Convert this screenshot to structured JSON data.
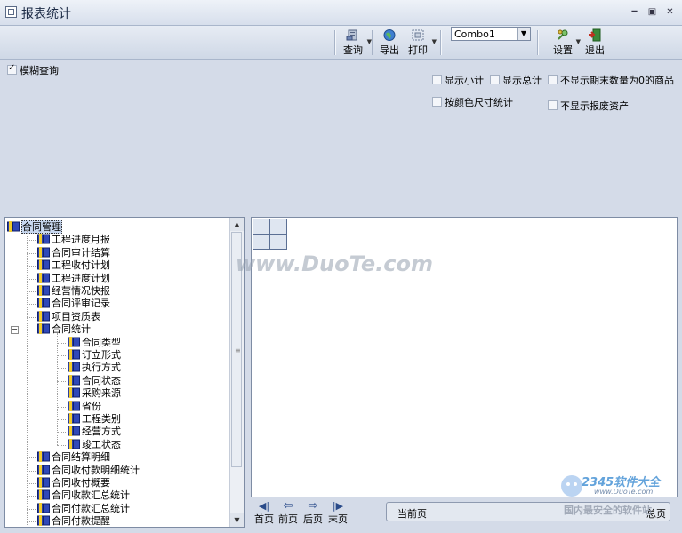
{
  "window": {
    "title": "报表统计"
  },
  "toolbar": {
    "query_label": "查询",
    "export_label": "导出",
    "print_label": "打印",
    "combo_value": "Combo1",
    "settings_label": "设置",
    "exit_label": "退出"
  },
  "options": {
    "fuzzy_query": "模糊查询",
    "show_subtotal": "显示小计",
    "show_total": "显示总计",
    "hide_zero_end_qty": "不显示期末数量为0的商品",
    "stat_by_color_size": "按颜色尺寸统计",
    "hide_scrapped_assets": "不显示报废资产"
  },
  "tree": {
    "root": "合同管理",
    "items": [
      "工程进度月报",
      "合同审计结算",
      "工程收付计划",
      "工程进度计划",
      "经营情况快报",
      "合同评审记录",
      "项目资质表",
      "合同统计"
    ],
    "stats_children": [
      "合同类型",
      "订立形式",
      "执行方式",
      "合同状态",
      "采购来源",
      "省份",
      "工程类别",
      "经营方式",
      "竣工状态"
    ],
    "items_after": [
      "合同结算明细",
      "合同收付款明细统计",
      "合同收付概要",
      "合同收款汇总统计",
      "合同付款汇总统计",
      "合同付款提醒"
    ]
  },
  "pager": {
    "first": "首页",
    "prev": "前页",
    "next": "后页",
    "last": "末页",
    "current_label": "当前页",
    "total_label": "总页"
  },
  "watermark": {
    "duote": "www.DuoTe.com",
    "brand": "2345软件大全",
    "brand_url": "www.DuoTe.com",
    "slogan": "国内最安全的软件站"
  }
}
